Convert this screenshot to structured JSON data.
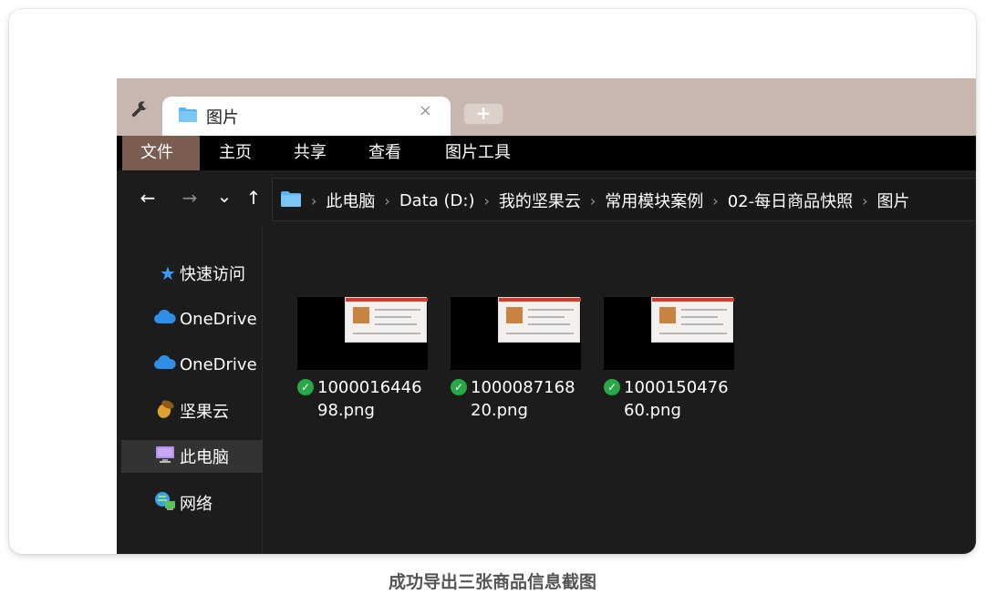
{
  "tab": {
    "title": "图片",
    "close_glyph": "×",
    "new_tab_glyph": "+"
  },
  "ribbon": {
    "items": [
      "文件",
      "主页",
      "共享",
      "查看",
      "图片工具"
    ]
  },
  "nav": {
    "back": "←",
    "forward": "→",
    "recent": "⌄",
    "up": "↑"
  },
  "breadcrumb": [
    "此电脑",
    "Data (D:)",
    "我的坚果云",
    "常用模块案例",
    "02-每日商品快照",
    "图片"
  ],
  "breadcrumb_separator": "›",
  "sidebar": {
    "items": [
      {
        "label": "快速访问",
        "icon": "star-icon"
      },
      {
        "label": "OneDrive",
        "icon": "cloud-icon"
      },
      {
        "label": "OneDrive",
        "icon": "cloud-icon"
      },
      {
        "label": "坚果云",
        "icon": "acorn-icon"
      },
      {
        "label": "此电脑",
        "icon": "monitor-icon"
      },
      {
        "label": "网络",
        "icon": "network-icon"
      }
    ],
    "selected": "此电脑"
  },
  "files": [
    {
      "name": "100001644698.png",
      "status": "synced"
    },
    {
      "name": "100008716820.png",
      "status": "synced"
    },
    {
      "name": "100015047660.png",
      "status": "synced"
    }
  ],
  "caption": "成功导出三张商品信息截图",
  "colors": {
    "tab_bar": "#c8b7ae",
    "ribbon_active": "#7a5c50",
    "explorer_bg": "#1c1c1c",
    "sync_check": "#27a844",
    "folder_blue": "#5ab4f0"
  }
}
